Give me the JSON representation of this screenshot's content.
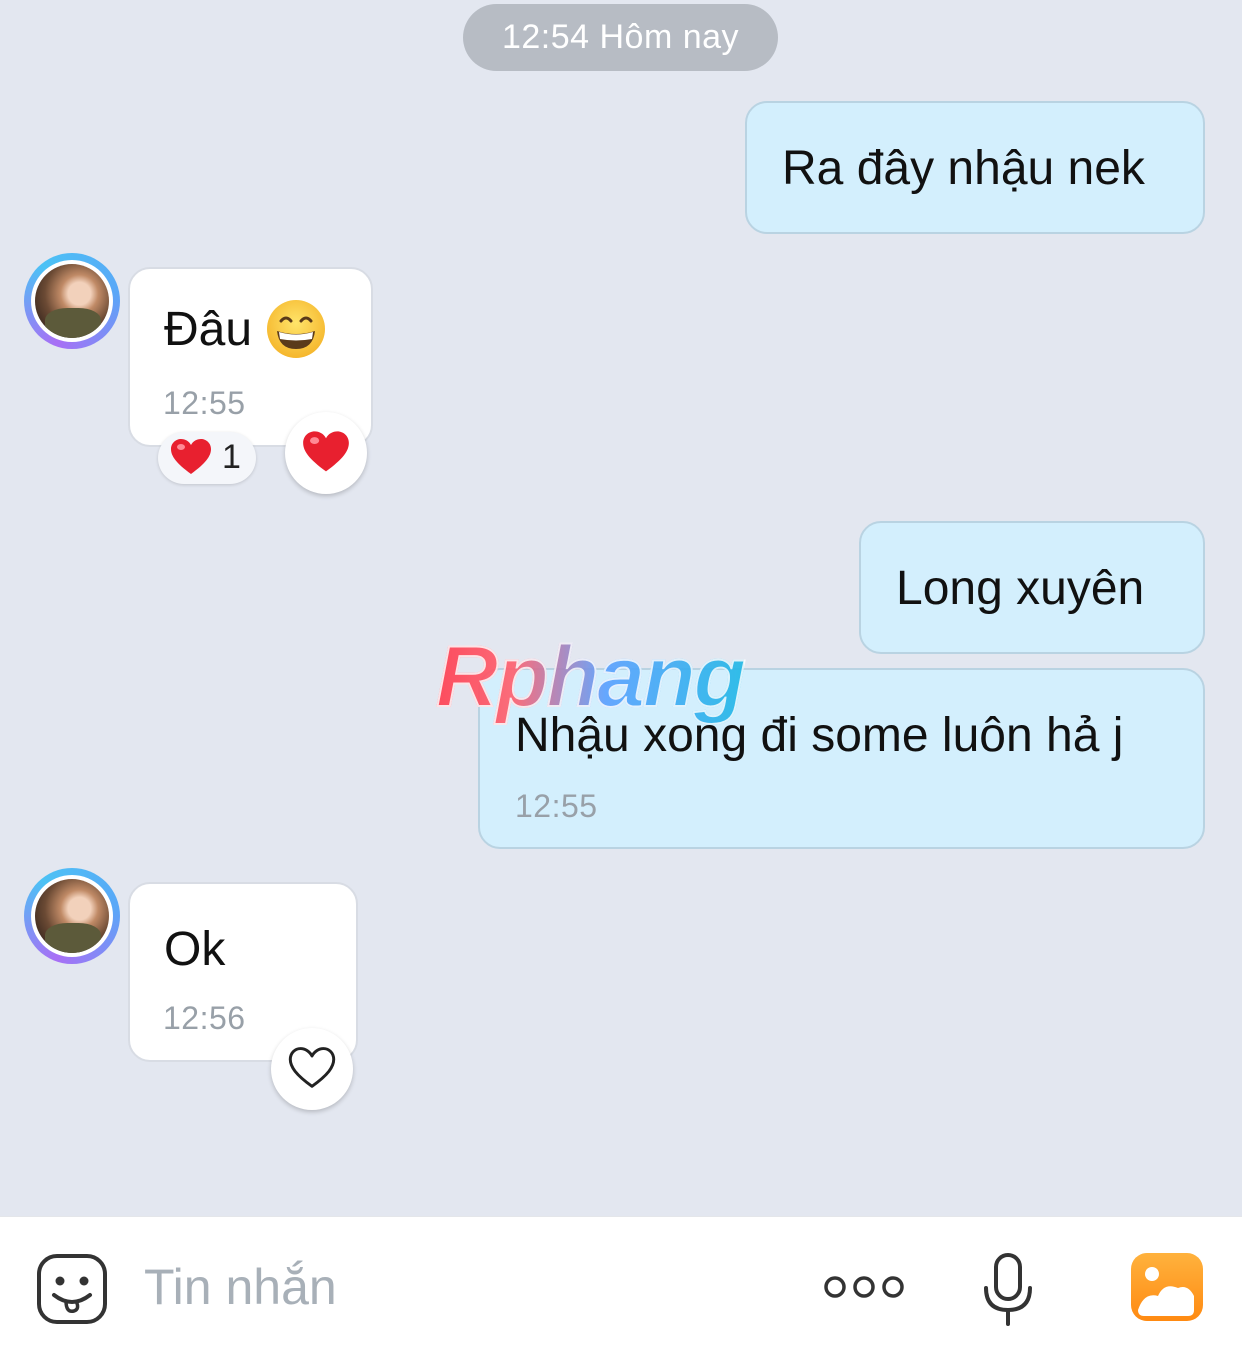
{
  "header": {
    "date_separator": "12:54 Hôm nay"
  },
  "messages": [
    {
      "direction": "out",
      "text": "Ra đây nhậu nek"
    },
    {
      "direction": "in",
      "text": "Đâu",
      "emoji": "grinning-face-emoji",
      "time": "12:55",
      "reaction": {
        "icon": "heart-icon",
        "count": "1"
      }
    },
    {
      "direction": "out",
      "text": "Long xuyên"
    },
    {
      "direction": "out",
      "text": "Nhậu xong đi some luôn hả j",
      "time": "12:55"
    },
    {
      "direction": "in",
      "text": "Ok",
      "time": "12:56"
    }
  ],
  "watermark": "Rphang",
  "composer": {
    "placeholder": "Tin nhắn"
  },
  "colors": {
    "background": "#e3e7f0",
    "out_bubble": "#d3effd",
    "in_bubble": "#ffffff",
    "accent_orange": "#ff9a1f"
  }
}
